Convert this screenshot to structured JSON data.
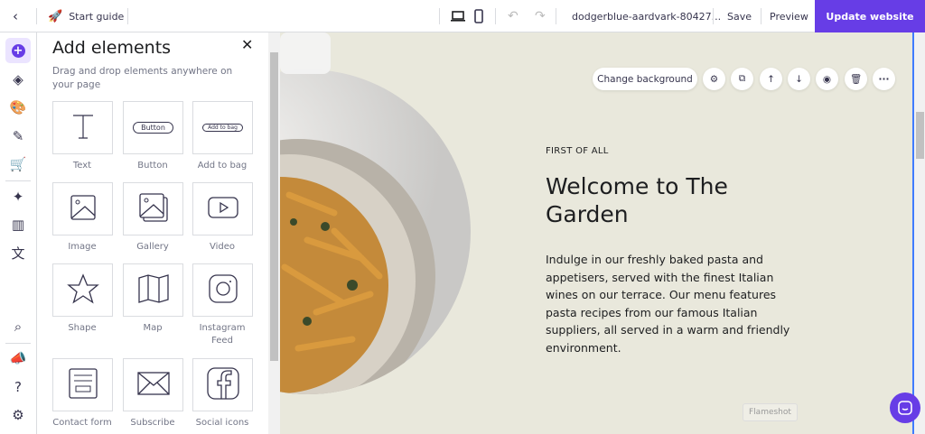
{
  "topbar": {
    "start_guide": "Start guide",
    "site_name": "dodgerblue-aardvark-80427...",
    "save": "Save",
    "preview": "Preview",
    "update": "Update website"
  },
  "panel": {
    "title": "Add elements",
    "subtitle": "Drag and drop elements anywhere on your page",
    "elements": [
      {
        "label": "Text",
        "icon": "text-icon"
      },
      {
        "label": "Button",
        "icon": "button-icon",
        "preview": "Button"
      },
      {
        "label": "Add to bag",
        "icon": "add-to-bag-icon",
        "preview": "Add to bag"
      },
      {
        "label": "Image",
        "icon": "image-icon"
      },
      {
        "label": "Gallery",
        "icon": "gallery-icon"
      },
      {
        "label": "Video",
        "icon": "video-icon"
      },
      {
        "label": "Shape",
        "icon": "star-icon"
      },
      {
        "label": "Map",
        "icon": "map-icon"
      },
      {
        "label": "Instagram Feed",
        "icon": "instagram-icon"
      },
      {
        "label": "Contact form",
        "icon": "form-icon"
      },
      {
        "label": "Subscribe",
        "icon": "envelope-icon"
      },
      {
        "label": "Social icons",
        "icon": "facebook-icon"
      }
    ]
  },
  "toolbar": {
    "change_background": "Change background"
  },
  "hero": {
    "eyebrow": "FIRST OF ALL",
    "title": "Welcome to The Garden",
    "body": "Indulge in our freshly baked pasta and appetisers, served with the finest Italian wines on our terrace. Our menu features pasta recipes from our famous Italian suppliers, all served in a warm and friendly environment."
  },
  "watermark": "Flameshot",
  "colors": {
    "accent": "#673de6",
    "canvas": "#e9e8dc"
  }
}
